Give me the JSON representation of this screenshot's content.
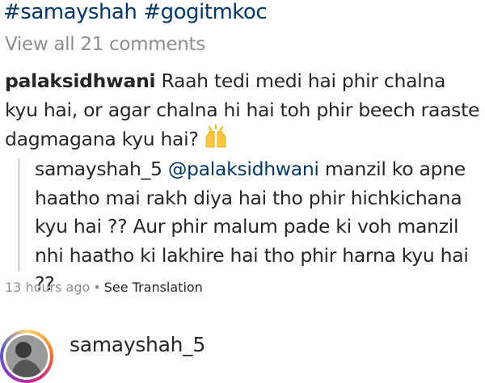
{
  "caption": {
    "hashtags": [
      "#samayshah",
      "#gogitmkoc"
    ]
  },
  "comments": {
    "view_all_label": "View all 21 comments",
    "main": {
      "username": "palaksidhwani",
      "text": "Raah tedi medi hai phir chalna kyu hai, or agar chalna hi hai toh phir beech raaste dagmagana kyu hai?",
      "emoji": "raising-hands-emoji"
    },
    "reply": {
      "username": "samayshah_5",
      "mention": "@palaksidhwani",
      "text": "manzil ko apne haatho mai rakh diya  hai tho phir hichkichana kyu hai ?? Aur phir malum pade ki voh manzil nhi haatho ki lakhire hai tho phir harna kyu hai ??"
    },
    "meta": {
      "time": "13 hours ago",
      "separator": "•",
      "translate_label": "See Translation"
    }
  },
  "post_header": {
    "username": "samayshah_5"
  },
  "colors": {
    "link": "#00376b",
    "muted": "#8e8e8e",
    "text": "#262626"
  }
}
